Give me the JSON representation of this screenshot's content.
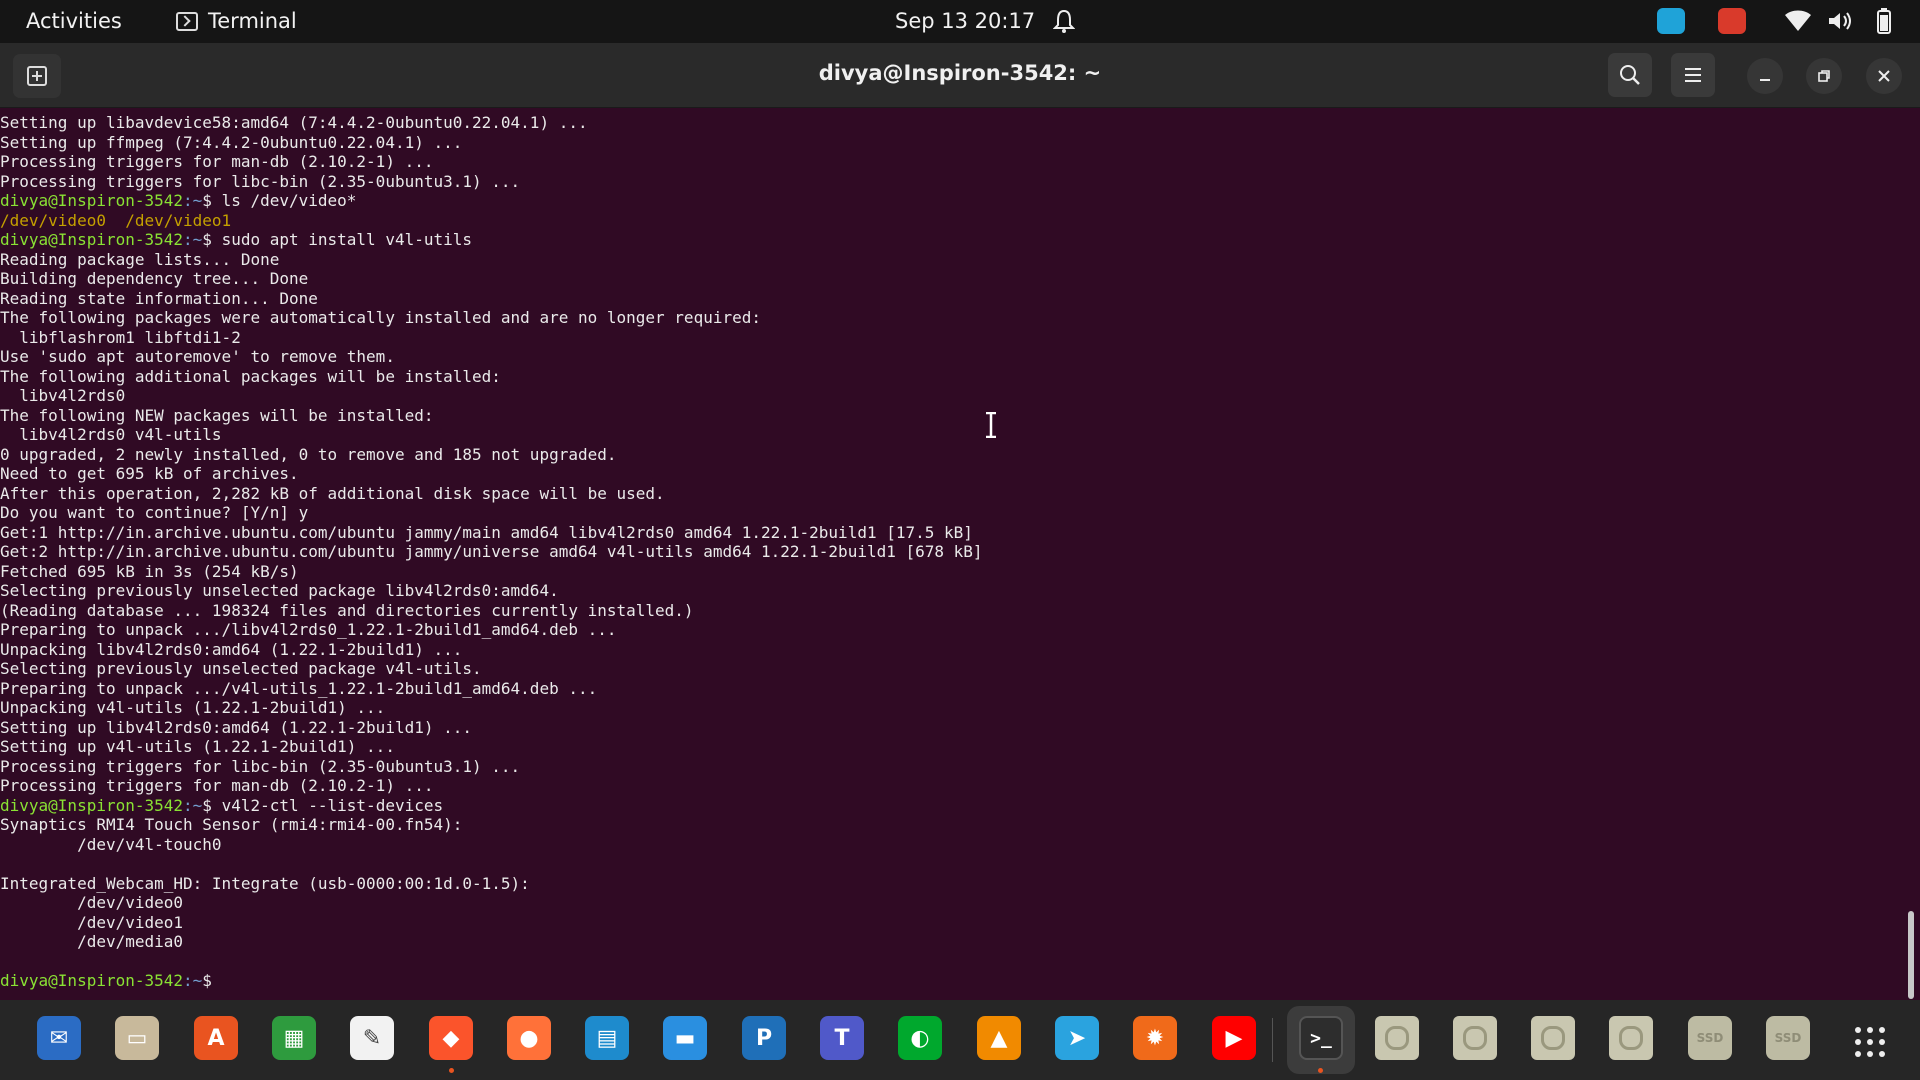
{
  "topbar": {
    "activities": "Activities",
    "app_name": "Terminal",
    "clock": "Sep 13  20:17"
  },
  "window": {
    "title": "divya@Inspiron-3542: ~"
  },
  "terminal": {
    "user_host": "divya@Inspiron-3542",
    "prompt_suffix": ":~$ ",
    "lines": [
      {
        "kind": "out",
        "text": "Setting up libavdevice58:amd64 (7:4.4.2-0ubuntu0.22.04.1) ..."
      },
      {
        "kind": "out",
        "text": "Setting up ffmpeg (7:4.4.2-0ubuntu0.22.04.1) ..."
      },
      {
        "kind": "out",
        "text": "Processing triggers for man-db (2.10.2-1) ..."
      },
      {
        "kind": "out",
        "text": "Processing triggers for libc-bin (2.35-0ubuntu3.1) ..."
      },
      {
        "kind": "cmd",
        "text": "ls /dev/video*"
      },
      {
        "kind": "ls",
        "text": "/dev/video0  /dev/video1"
      },
      {
        "kind": "cmd",
        "text": "sudo apt install v4l-utils"
      },
      {
        "kind": "out",
        "text": "Reading package lists... Done"
      },
      {
        "kind": "out",
        "text": "Building dependency tree... Done"
      },
      {
        "kind": "out",
        "text": "Reading state information... Done"
      },
      {
        "kind": "out",
        "text": "The following packages were automatically installed and are no longer required:"
      },
      {
        "kind": "out",
        "text": "  libflashrom1 libftdi1-2"
      },
      {
        "kind": "out",
        "text": "Use 'sudo apt autoremove' to remove them."
      },
      {
        "kind": "out",
        "text": "The following additional packages will be installed:"
      },
      {
        "kind": "out",
        "text": "  libv4l2rds0"
      },
      {
        "kind": "out",
        "text": "The following NEW packages will be installed:"
      },
      {
        "kind": "out",
        "text": "  libv4l2rds0 v4l-utils"
      },
      {
        "kind": "out",
        "text": "0 upgraded, 2 newly installed, 0 to remove and 185 not upgraded."
      },
      {
        "kind": "out",
        "text": "Need to get 695 kB of archives."
      },
      {
        "kind": "out",
        "text": "After this operation, 2,282 kB of additional disk space will be used."
      },
      {
        "kind": "out",
        "text": "Do you want to continue? [Y/n] y"
      },
      {
        "kind": "out",
        "text": "Get:1 http://in.archive.ubuntu.com/ubuntu jammy/main amd64 libv4l2rds0 amd64 1.22.1-2build1 [17.5 kB]"
      },
      {
        "kind": "out",
        "text": "Get:2 http://in.archive.ubuntu.com/ubuntu jammy/universe amd64 v4l-utils amd64 1.22.1-2build1 [678 kB]"
      },
      {
        "kind": "out",
        "text": "Fetched 695 kB in 3s (254 kB/s)"
      },
      {
        "kind": "out",
        "text": "Selecting previously unselected package libv4l2rds0:amd64."
      },
      {
        "kind": "out",
        "text": "(Reading database ... 198324 files and directories currently installed.)"
      },
      {
        "kind": "out",
        "text": "Preparing to unpack .../libv4l2rds0_1.22.1-2build1_amd64.deb ..."
      },
      {
        "kind": "out",
        "text": "Unpacking libv4l2rds0:amd64 (1.22.1-2build1) ..."
      },
      {
        "kind": "out",
        "text": "Selecting previously unselected package v4l-utils."
      },
      {
        "kind": "out",
        "text": "Preparing to unpack .../v4l-utils_1.22.1-2build1_amd64.deb ..."
      },
      {
        "kind": "out",
        "text": "Unpacking v4l-utils (1.22.1-2build1) ..."
      },
      {
        "kind": "out",
        "text": "Setting up libv4l2rds0:amd64 (1.22.1-2build1) ..."
      },
      {
        "kind": "out",
        "text": "Setting up v4l-utils (1.22.1-2build1) ..."
      },
      {
        "kind": "out",
        "text": "Processing triggers for libc-bin (2.35-0ubuntu3.1) ..."
      },
      {
        "kind": "out",
        "text": "Processing triggers for man-db (2.10.2-1) ..."
      },
      {
        "kind": "cmd",
        "text": "v4l2-ctl --list-devices"
      },
      {
        "kind": "out",
        "text": "Synaptics RMI4 Touch Sensor (rmi4:rmi4-00.fn54):"
      },
      {
        "kind": "out",
        "text": "        /dev/v4l-touch0"
      },
      {
        "kind": "out",
        "text": ""
      },
      {
        "kind": "out",
        "text": "Integrated_Webcam_HD: Integrate (usb-0000:00:1d.0-1.5):"
      },
      {
        "kind": "out",
        "text": "        /dev/video0"
      },
      {
        "kind": "out",
        "text": "        /dev/video1"
      },
      {
        "kind": "out",
        "text": "        /dev/media0"
      },
      {
        "kind": "out",
        "text": ""
      },
      {
        "kind": "cmd",
        "text": ""
      }
    ]
  },
  "dock": {
    "apps": [
      {
        "name": "thunderbird-icon",
        "color": "#2b6cc4",
        "glyph": "✉"
      },
      {
        "name": "files-icon",
        "color": "#c8b99b",
        "glyph": "▭"
      },
      {
        "name": "software-icon",
        "color": "#e95420",
        "glyph": "A"
      },
      {
        "name": "calc-icon",
        "color": "#2e9b3e",
        "glyph": "▦"
      },
      {
        "name": "text-editor-icon",
        "color": "#f2f2f2",
        "glyph": "✎"
      },
      {
        "name": "brave-icon",
        "color": "#fb542b",
        "glyph": "◆"
      },
      {
        "name": "firefox-icon",
        "color": "#ff7139",
        "glyph": "●"
      },
      {
        "name": "writer-icon",
        "color": "#1e8bcd",
        "glyph": "▤"
      },
      {
        "name": "notes-icon",
        "color": "#2a8fe0",
        "glyph": "▬"
      },
      {
        "name": "pycharm-icon",
        "color": "#1f6fb8",
        "glyph": "P"
      },
      {
        "name": "teams-icon",
        "color": "#5059c9",
        "glyph": "T"
      },
      {
        "name": "evernote-icon",
        "color": "#00a82d",
        "glyph": "◐"
      },
      {
        "name": "vlc-icon",
        "color": "#f18a00",
        "glyph": "▲"
      },
      {
        "name": "telegram-icon",
        "color": "#2aa3df",
        "glyph": "➤"
      },
      {
        "name": "xnview-icon",
        "color": "#f06a1a",
        "glyph": "✹"
      },
      {
        "name": "youtube-icon",
        "color": "#ff0000",
        "glyph": "▶"
      }
    ],
    "terminal_icon": "terminal-icon",
    "disks": [
      "disk-icon",
      "disk-icon",
      "disk-icon",
      "disk-icon"
    ],
    "ssd_label": "SSD"
  }
}
